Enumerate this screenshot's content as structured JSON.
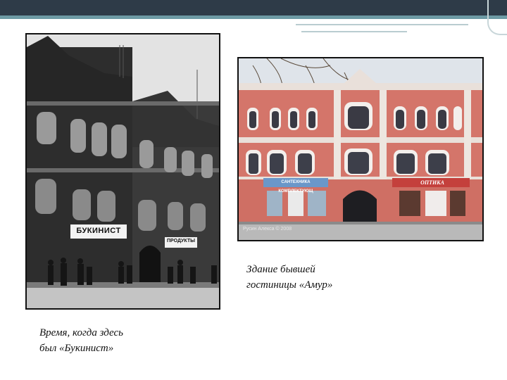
{
  "photo_old": {
    "sign_main": "БУКИНИСТ",
    "sign_second": "ПРОДУКТЫ"
  },
  "photo_new": {
    "sign_plumbing": "САНТЕХНИКА КОМПЛЕКТУЮЩ",
    "sign_optics": "ОПТИКА",
    "credit": "Русин Алекса © 2008"
  },
  "captions": {
    "left_line1": "Время, когда здесь",
    "left_line2": "был «Букинист»",
    "right_line1": "Здание бывшей",
    "right_line2": "гостиницы «Амур»"
  }
}
